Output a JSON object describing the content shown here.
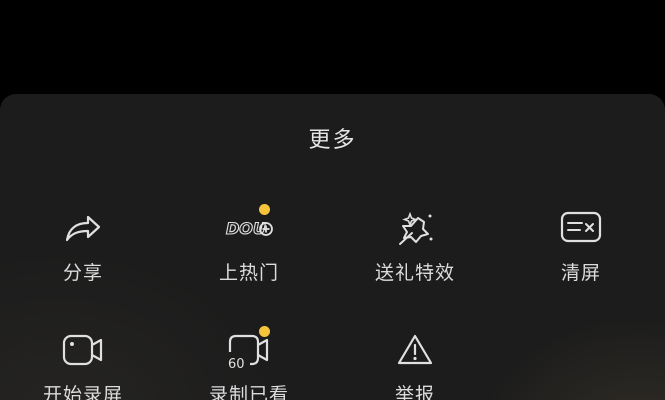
{
  "sheet": {
    "title": "更多"
  },
  "actions": [
    {
      "label": "分享",
      "icon": "share-icon",
      "badge": false
    },
    {
      "label": "上热门",
      "icon": "dou-plus-icon",
      "icon_text": "DOU",
      "badge": true
    },
    {
      "label": "送礼特效",
      "icon": "gift-effect-icon",
      "badge": false
    },
    {
      "label": "清屏",
      "icon": "clear-screen-icon",
      "badge": false
    },
    {
      "label": "开始录屏",
      "icon": "screen-record-icon",
      "badge": false
    },
    {
      "label": "录制已看",
      "icon": "record-watched-icon",
      "icon_text": "60",
      "badge": true
    },
    {
      "label": "举报",
      "icon": "report-warning-icon",
      "badge": false
    }
  ],
  "colors": {
    "background": "#000000",
    "sheet": "#1c1c1c",
    "text": "#dcdcdc",
    "badge": "#f5c43b"
  }
}
